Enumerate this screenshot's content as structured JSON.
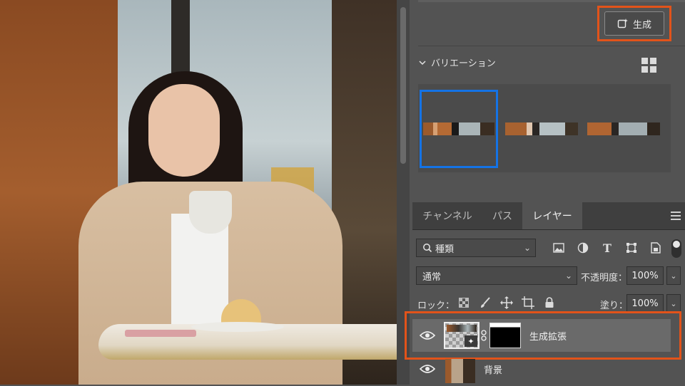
{
  "properties_panel": {
    "generate_button_label": "生成",
    "variations_label": "バリエーション",
    "selected_variation": 1
  },
  "layers_panel": {
    "tabs": [
      "チャンネル",
      "パス",
      "レイヤー"
    ],
    "active_tab": "レイヤー",
    "filter_kind": "種類",
    "blend_mode": "通常",
    "opacity_label": "不透明度：",
    "opacity_value": "100%",
    "lock_label": "ロック：",
    "fill_label": "塗り：",
    "fill_value": "100%",
    "layers": [
      {
        "name": "生成拡張",
        "selected": true,
        "visible": true
      },
      {
        "name": "背景",
        "selected": false,
        "visible": true
      }
    ]
  },
  "colors": {
    "panel_bg": "#535353",
    "highlight_orange": "#e2531a",
    "selection_blue": "#1473e6"
  },
  "icons": [
    "generate-icon",
    "chevron-down-icon",
    "grid-view-icon",
    "hamburger-menu-icon",
    "search-icon",
    "image-filter-icon",
    "adjustment-filter-icon",
    "type-filter-icon",
    "shape-filter-icon",
    "smart-object-filter-icon",
    "lock-transparency-icon",
    "lock-paint-icon",
    "lock-position-icon",
    "lock-artboard-icon",
    "lock-all-icon",
    "eye-icon",
    "link-icon"
  ]
}
